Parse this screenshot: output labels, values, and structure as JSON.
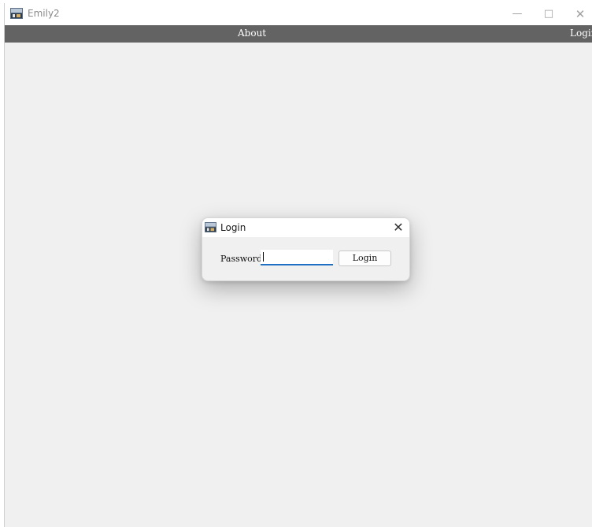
{
  "window": {
    "title": "Emily2",
    "controls": {
      "minimize": "—",
      "maximize": "□",
      "close": "✕"
    }
  },
  "menubar": {
    "items": [
      {
        "label": "About"
      },
      {
        "label": "Login"
      }
    ]
  },
  "dialog": {
    "title": "Login",
    "close": "✕",
    "password_label": "Password:",
    "password_value": "",
    "login_button": "Login"
  },
  "colors": {
    "menubar_bg": "#636363",
    "content_bg": "#f0f0f0",
    "input_underline": "#1f6fc5"
  },
  "icons": {
    "app": "app-icon",
    "dialog": "dialog-app-icon"
  }
}
